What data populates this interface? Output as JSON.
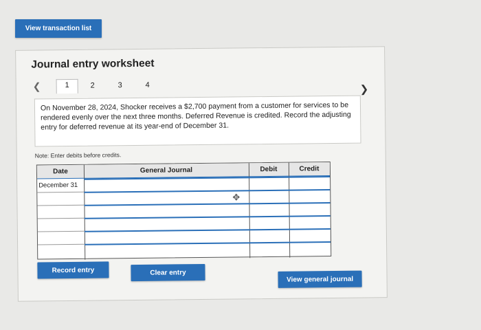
{
  "top": {
    "view_transactions_label": "View transaction list"
  },
  "worksheet": {
    "title": "Journal entry worksheet",
    "tabs": [
      "1",
      "2",
      "3",
      "4"
    ],
    "active_tab": "1",
    "description": "On November 28, 2024, Shocker receives a $2,700 payment from a customer for services to be rendered evenly over the next three months. Deferred Revenue is credited. Record the adjusting entry for deferred revenue at its year-end of December 31.",
    "note": "Note: Enter debits before credits."
  },
  "table": {
    "headers": {
      "date": "Date",
      "general_journal": "General Journal",
      "debit": "Debit",
      "credit": "Credit"
    },
    "rows": [
      {
        "date": "December 31"
      },
      {
        "date": ""
      },
      {
        "date": ""
      },
      {
        "date": ""
      },
      {
        "date": ""
      },
      {
        "date": ""
      }
    ]
  },
  "buttons": {
    "record_entry": "Record entry",
    "clear_entry": "Clear entry",
    "view_general_journal": "View general journal"
  },
  "colors": {
    "accent": "#2a6fb8"
  }
}
